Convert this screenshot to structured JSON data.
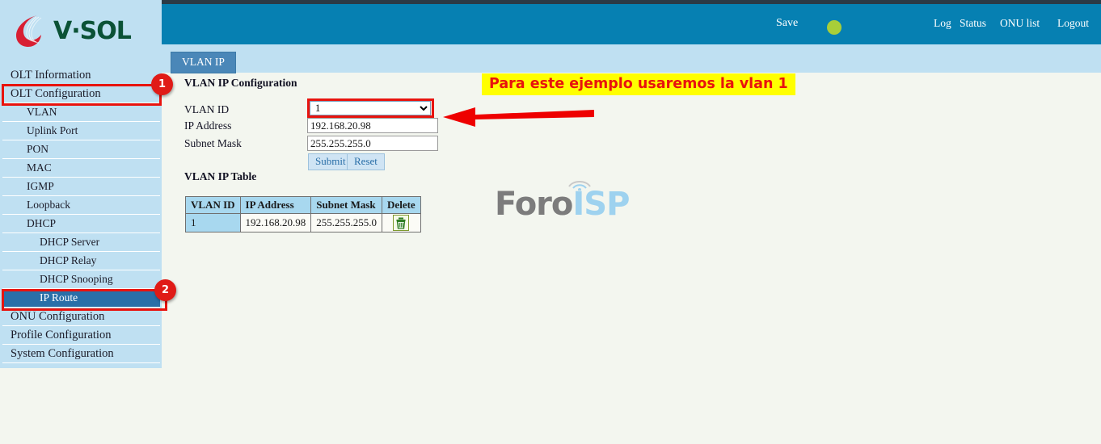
{
  "header": {
    "save_label": "Save",
    "status_dot": "status-indicator-green",
    "status_dot_color": "#a8ce39",
    "links": [
      {
        "label": "Log",
        "name": "log"
      },
      {
        "label": "Status",
        "name": "status"
      },
      {
        "label": "ONU list",
        "name": "onu-list"
      },
      {
        "label": "Logout",
        "name": "logout"
      }
    ],
    "bar_color": "#0680b2"
  },
  "brand": {
    "name": "V·SOL",
    "logo_icon": "vsol-flame-logo-icon",
    "logo_mark_color": "#d81f33",
    "text_color": "#0b5236"
  },
  "sidebar": {
    "bg_color": "#bfe0f2",
    "active_color": "#2a6fa8",
    "items": [
      {
        "label": "OLT Information",
        "level": 1,
        "active": false
      },
      {
        "label": "OLT Configuration",
        "level": 1,
        "active": false
      },
      {
        "label": "VLAN",
        "level": 2,
        "active": false
      },
      {
        "label": "Uplink Port",
        "level": 2,
        "active": false
      },
      {
        "label": "PON",
        "level": 2,
        "active": false
      },
      {
        "label": "MAC",
        "level": 2,
        "active": false
      },
      {
        "label": "IGMP",
        "level": 2,
        "active": false
      },
      {
        "label": "Loopback",
        "level": 2,
        "active": false
      },
      {
        "label": "DHCP",
        "level": 2,
        "active": false
      },
      {
        "label": "DHCP Server",
        "level": 3,
        "active": false
      },
      {
        "label": "DHCP Relay",
        "level": 3,
        "active": false
      },
      {
        "label": "DHCP Snooping",
        "level": 3,
        "active": false
      },
      {
        "label": "IP Route",
        "level": 3,
        "active": true
      },
      {
        "label": "ONU Configuration",
        "level": 1,
        "active": false
      },
      {
        "label": "Profile Configuration",
        "level": 1,
        "active": false
      },
      {
        "label": "System Configuration",
        "level": 1,
        "active": false
      }
    ]
  },
  "main": {
    "tab_label": "VLAN IP",
    "config_title": "VLAN IP Configuration",
    "table_title": "VLAN IP Table",
    "form": {
      "vlan_id_label": "VLAN ID",
      "vlan_id_value": "1",
      "vlan_id_options": [
        "1"
      ],
      "ip_label": "IP Address",
      "ip_value": "192.168.20.98",
      "mask_label": "Subnet Mask",
      "mask_value": "255.255.255.0",
      "submit_label": "Submit",
      "reset_label": "Reset"
    },
    "table": {
      "columns": [
        "VLAN ID",
        "IP Address",
        "Subnet Mask",
        "Delete"
      ],
      "rows": [
        {
          "vlan_id": "1",
          "ip": "192.168.20.98",
          "mask": "255.255.255.0",
          "delete_icon": "trash-icon"
        }
      ]
    }
  },
  "watermark": {
    "part1": "Foro",
    "part2": "ISP"
  },
  "annotations": {
    "banner_text": "Para este ejemplo usaremos la vlan 1",
    "banner_bg": "#ffff00",
    "banner_fg": "#e8130e",
    "highlight_color": "#e8130e",
    "badges": [
      {
        "number": "1",
        "target": "OLT Configuration"
      },
      {
        "number": "2",
        "target": "IP Route"
      }
    ],
    "arrow": "red-arrow-pointing-left"
  }
}
